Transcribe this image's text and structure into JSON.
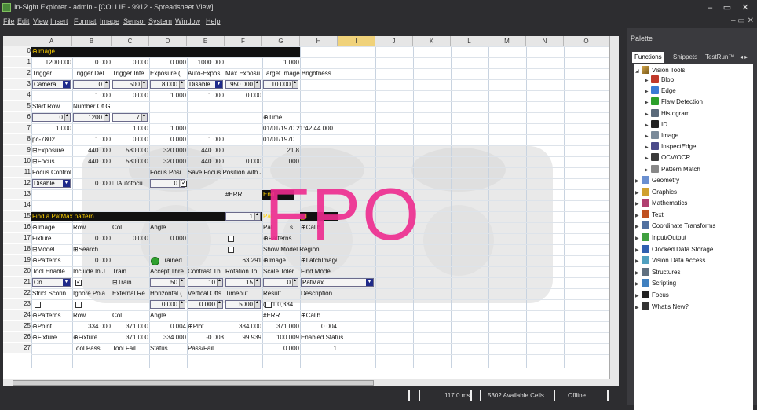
{
  "window": {
    "title": "In-Sight Explorer - admin - [COLLIE - 9912 - Spreadsheet View]",
    "controls": [
      "–",
      "▭",
      "✕"
    ]
  },
  "menu": [
    "File",
    "Edit",
    "View",
    "Insert",
    "Format",
    "Image",
    "Sensor",
    "System",
    "Window",
    "Help"
  ],
  "columns": [
    "A",
    "B",
    "C",
    "D",
    "E",
    "F",
    "G",
    "H",
    "I",
    "J",
    "K",
    "L",
    "M",
    "N",
    "O"
  ],
  "rows": [
    "0",
    "1",
    "2",
    "3",
    "4",
    "5",
    "6",
    "7",
    "8",
    "9",
    "10",
    "11",
    "12",
    "13",
    "14",
    "15",
    "16",
    "17",
    "18",
    "19",
    "20",
    "21",
    "22",
    "23",
    "24",
    "25",
    "26",
    "27"
  ],
  "cells": {
    "r0a": "⊕Image",
    "r1a": "1200.000",
    "r1b": "0.000",
    "r1c": "0.000",
    "r1d": "0.000",
    "r1e": "1000.000",
    "r1g": "1.000",
    "r2a": "Trigger",
    "r2b": "Trigger Del",
    "r2c": "Trigger Inte",
    "r2d": "Exposure (",
    "r2e": "Auto-Expos",
    "r2f": "Max Exposu",
    "r2g": "Target Image Brightness",
    "r3a": "Camera",
    "r3b": "0",
    "r3c": "500",
    "r3d": "8.000",
    "r3e": "Disable",
    "r3f": "950.000",
    "r3g": "10.000",
    "r4b": "1.000",
    "r4c": "0.000",
    "r4d": "1.000",
    "r4e": "1.000",
    "r4f": "0.000",
    "r5a": "Start Row",
    "r5b": "Number Of Gain",
    "r6a": "0",
    "r6b": "1200",
    "r6c": "7",
    "r6g": "⊕Time",
    "r7a": "1.000",
    "r7c": "1.000",
    "r7d": "1.000",
    "r7g": "01/01/1970 21:42:44.000",
    "r8a": "pc-7802",
    "r8b": "1.000",
    "r8c": "0.000",
    "r8d": "0.000",
    "r8e": "1.000",
    "r8g": "01/01/1970",
    "r9a": "⊞Exposure",
    "r9b": "440.000",
    "r9c": "580.000",
    "r9d": "320.000",
    "r9e": "440.000",
    "r9g": "21.8",
    "r10a": "⊞Focus",
    "r10b": "440.000",
    "r10c": "580.000",
    "r10d": "320.000",
    "r10e": "440.000",
    "r10f": "0.000",
    "r10g": "000",
    "r11a": "Focus Controls",
    "r11d": "Focus Posi",
    "r11e": "Save Focus Position with J",
    "r12a": "Disable",
    "r12b": "0.000",
    "r12c": "☐Autofocu",
    "r12d": "0",
    "r13f": "#ERR",
    "r13g": "End",
    "r15a": "Find a PatMax pattern",
    "r15f": "1",
    "r15g": "Pat",
    "r15h": "_1",
    "r16a": "⊕Image",
    "r16b": "Row",
    "r16c": "Col",
    "r16d": "Angle",
    "r16g": "Pat",
    "r16g2": "s",
    "r16h": "⊕Calib",
    "r17a": "Fixture",
    "r17b": "0.000",
    "r17c": "0.000",
    "r17d": "0.000",
    "r17g": "⊕Patterns",
    "r18a": "⊞Model",
    "r18b": "⊞Search",
    "r18g": "Show Model Region",
    "r19a": "⊕Patterns",
    "r19b": "0.000",
    "r19d": "Trained",
    "r19f": "63.291",
    "r19g": "⊕Image",
    "r19h": "⊕LatchImage",
    "r20a": "Tool Enable",
    "r20b": "Include In J",
    "r20c": "Train",
    "r20d": "Accept Thre",
    "r20e": "Contrast Th",
    "r20f": "Rotation To",
    "r20g": "Scale Toler",
    "r20h": "Find Mode",
    "r21a": "On",
    "r21c": "⊞Train",
    "r21d": "50",
    "r21e": "10",
    "r21f": "15",
    "r21g": "0",
    "r21h": "PatMax",
    "r22a": "Strict Scorin",
    "r22b": "Ignore Pola",
    "r22c": "External Re",
    "r22d": "Horizontal (",
    "r22e": "Vertical Offs",
    "r22f": "Timeout",
    "r22g": "Result",
    "r22h": "Description",
    "r23d": "0.000",
    "r23e": "0.000",
    "r23f": "5000",
    "r23g": "(371.0,334.",
    "r24a": "⊕Patterns",
    "r24b": "Row",
    "r24c": "Col",
    "r24d": "Angle",
    "r24g": "#ERR",
    "r24h": "⊕Calib",
    "r25a": "⊕Point",
    "r25b": "334.000",
    "r25c": "371.000",
    "r25d": "0.004",
    "r25e": "⊕Plot",
    "r25f": "334.000",
    "r25g": "371.000",
    "r25h": "0.004",
    "r26a": "⊕Fixture",
    "r26b": "⊕Fixture",
    "r26c": "371.000",
    "r26d": "334.000",
    "r26e": "-0.003",
    "r26f": "99.939",
    "r26g": "100.009",
    "r26h": "Enabled Status",
    "r27b": "Tool Pass",
    "r27c": "Tool Fail",
    "r27d": "Status",
    "r27e": "Pass/Fail",
    "r27g": "0.000",
    "r27h": "1"
  },
  "overlay_text": "FPO",
  "status": {
    "time": "117.0 ms",
    "cells": "5302 Available Cells",
    "mode": "Offline"
  },
  "palette": {
    "title": "Palette",
    "tabs": [
      "Functions",
      "Snippets",
      "TestRun™"
    ],
    "tab_arrows": "◂ ▸",
    "vision_tools": "Vision Tools",
    "vision_children": [
      "Blob",
      "Edge",
      "Flaw Detection",
      "Histogram",
      "ID",
      "Image",
      "InspectEdge",
      "OCV/OCR",
      "Pattern Match"
    ],
    "categories": [
      "Geometry",
      "Graphics",
      "Mathematics",
      "Text",
      "Coordinate Transforms",
      "Input/Output",
      "Clocked Data Storage",
      "Vision Data Access",
      "Structures",
      "Scripting",
      "Focus",
      "What's New?"
    ]
  }
}
